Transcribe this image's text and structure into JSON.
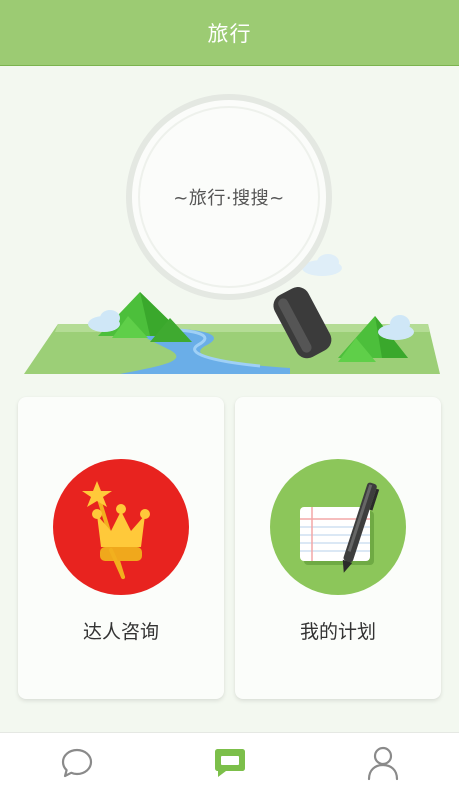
{
  "header": {
    "title": "旅行"
  },
  "hero": {
    "search_label": "~旅行·搜搜~",
    "search_icon": "magnifier-icon"
  },
  "cards": [
    {
      "label": "达人咨询",
      "icon": "crown-wand-icon",
      "color": "#e8231f"
    },
    {
      "label": "我的计划",
      "icon": "notebook-pen-icon",
      "color": "#8cc65a"
    }
  ],
  "bottom_nav": {
    "items": [
      {
        "icon": "chat-bubble-icon",
        "active": false
      },
      {
        "icon": "message-square-icon",
        "active": true
      },
      {
        "icon": "user-icon",
        "active": false
      }
    ]
  },
  "colors": {
    "header": "#9ccb73",
    "accent_green": "#8cc65a",
    "accent_red": "#e8231f",
    "nav_active": "#7cbf4a",
    "nav_inactive": "#8a8a8a",
    "background": "#f3f8f0"
  }
}
